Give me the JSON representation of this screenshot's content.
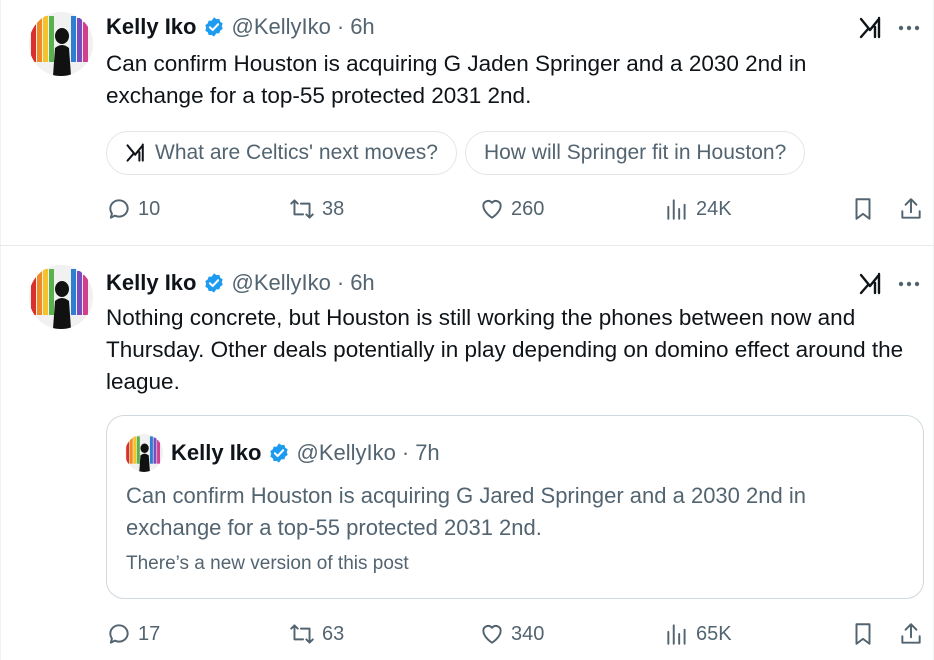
{
  "tweets": [
    {
      "author": {
        "name": "Kelly Iko",
        "handle": "@KellyIko",
        "time": "6h"
      },
      "text": "Can confirm Houston is acquiring G Jaden Springer and a 2030 2nd in exchange for a top-55 protected 2031 2nd.",
      "suggestions": [
        "What are Celtics' next moves?",
        "How will Springer fit in Houston?"
      ],
      "stats": {
        "replies": "10",
        "reposts": "38",
        "likes": "260",
        "views": "24K"
      }
    },
    {
      "author": {
        "name": "Kelly Iko",
        "handle": "@KellyIko",
        "time": "6h"
      },
      "text": "Nothing concrete, but Houston is still working the phones between now and Thursday. Other deals potentially in play depending on domino effect around the league.",
      "quote": {
        "author": {
          "name": "Kelly Iko",
          "handle": "@KellyIko",
          "time": "7h"
        },
        "text": "Can confirm Houston is acquiring G Jared Springer and a 2030 2nd in exchange for a top-55 protected 2031 2nd.",
        "note": "There’s a new version of this post"
      },
      "stats": {
        "replies": "17",
        "reposts": "63",
        "likes": "340",
        "views": "65K"
      }
    }
  ],
  "common": {
    "separator_dot": "·"
  },
  "colors": {
    "verified": "#1d9bf0",
    "text": "#0f1419",
    "secondary": "#536471",
    "border": "#cfd9de"
  }
}
